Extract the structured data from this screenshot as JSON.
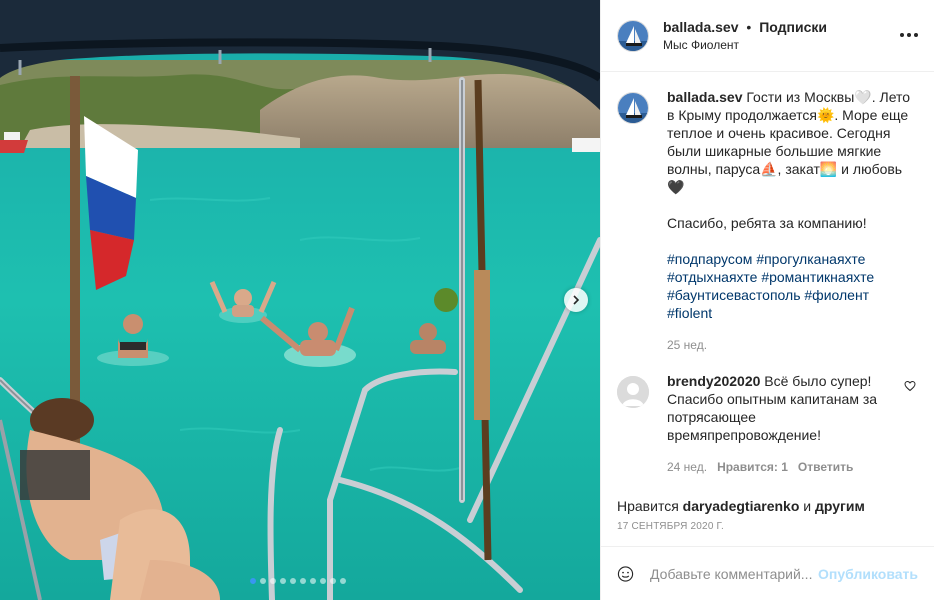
{
  "header": {
    "username": "ballada.sev",
    "separator": "•",
    "follow_label": "Подписки",
    "location": "Мыс Фиолент",
    "more_icon": "more-horizontal-icon"
  },
  "caption": {
    "username": "ballada.sev",
    "text": "Гости из Москвы🤍. Лето в Крыму продолжается🌞. Море еще теплое и очень красивое. Сегодня были шикарные большие мягкие волны, паруса⛵, закат🌅 и любовь🖤\n\nСпасибо, ребята за компанию!",
    "hashtags": [
      "#подпарусом",
      "#прогулканаяхте",
      "#отдыхнаяхте",
      "#романтикнаяхте",
      "#баунтисевастополь",
      "#фиолент",
      "#fiolent"
    ],
    "time": "25 нед."
  },
  "comments": [
    {
      "username": "brendy202020",
      "text": "Всё было супер! Спасибо опытным капитанам за потрясающее времяпрепровождение!",
      "time": "24 нед.",
      "likes_label": "Нравится: 1",
      "reply_label": "Ответить"
    }
  ],
  "likes": {
    "prefix": "Нравится",
    "user": "daryadegtiarenko",
    "conjunction": "и",
    "others": "другим"
  },
  "date": "17 сентября 2020 г.",
  "add_comment": {
    "placeholder": "Добавьте комментарий...",
    "publish_label": "Опубликовать"
  },
  "carousel": {
    "total": 10,
    "active_index": 0
  },
  "colors": {
    "accent_blue": "#3897f0",
    "hashtag": "#00376b",
    "muted": "#8e8e8e",
    "publish_disabled": "#b2dffc",
    "sea": "#1fb7ad"
  }
}
